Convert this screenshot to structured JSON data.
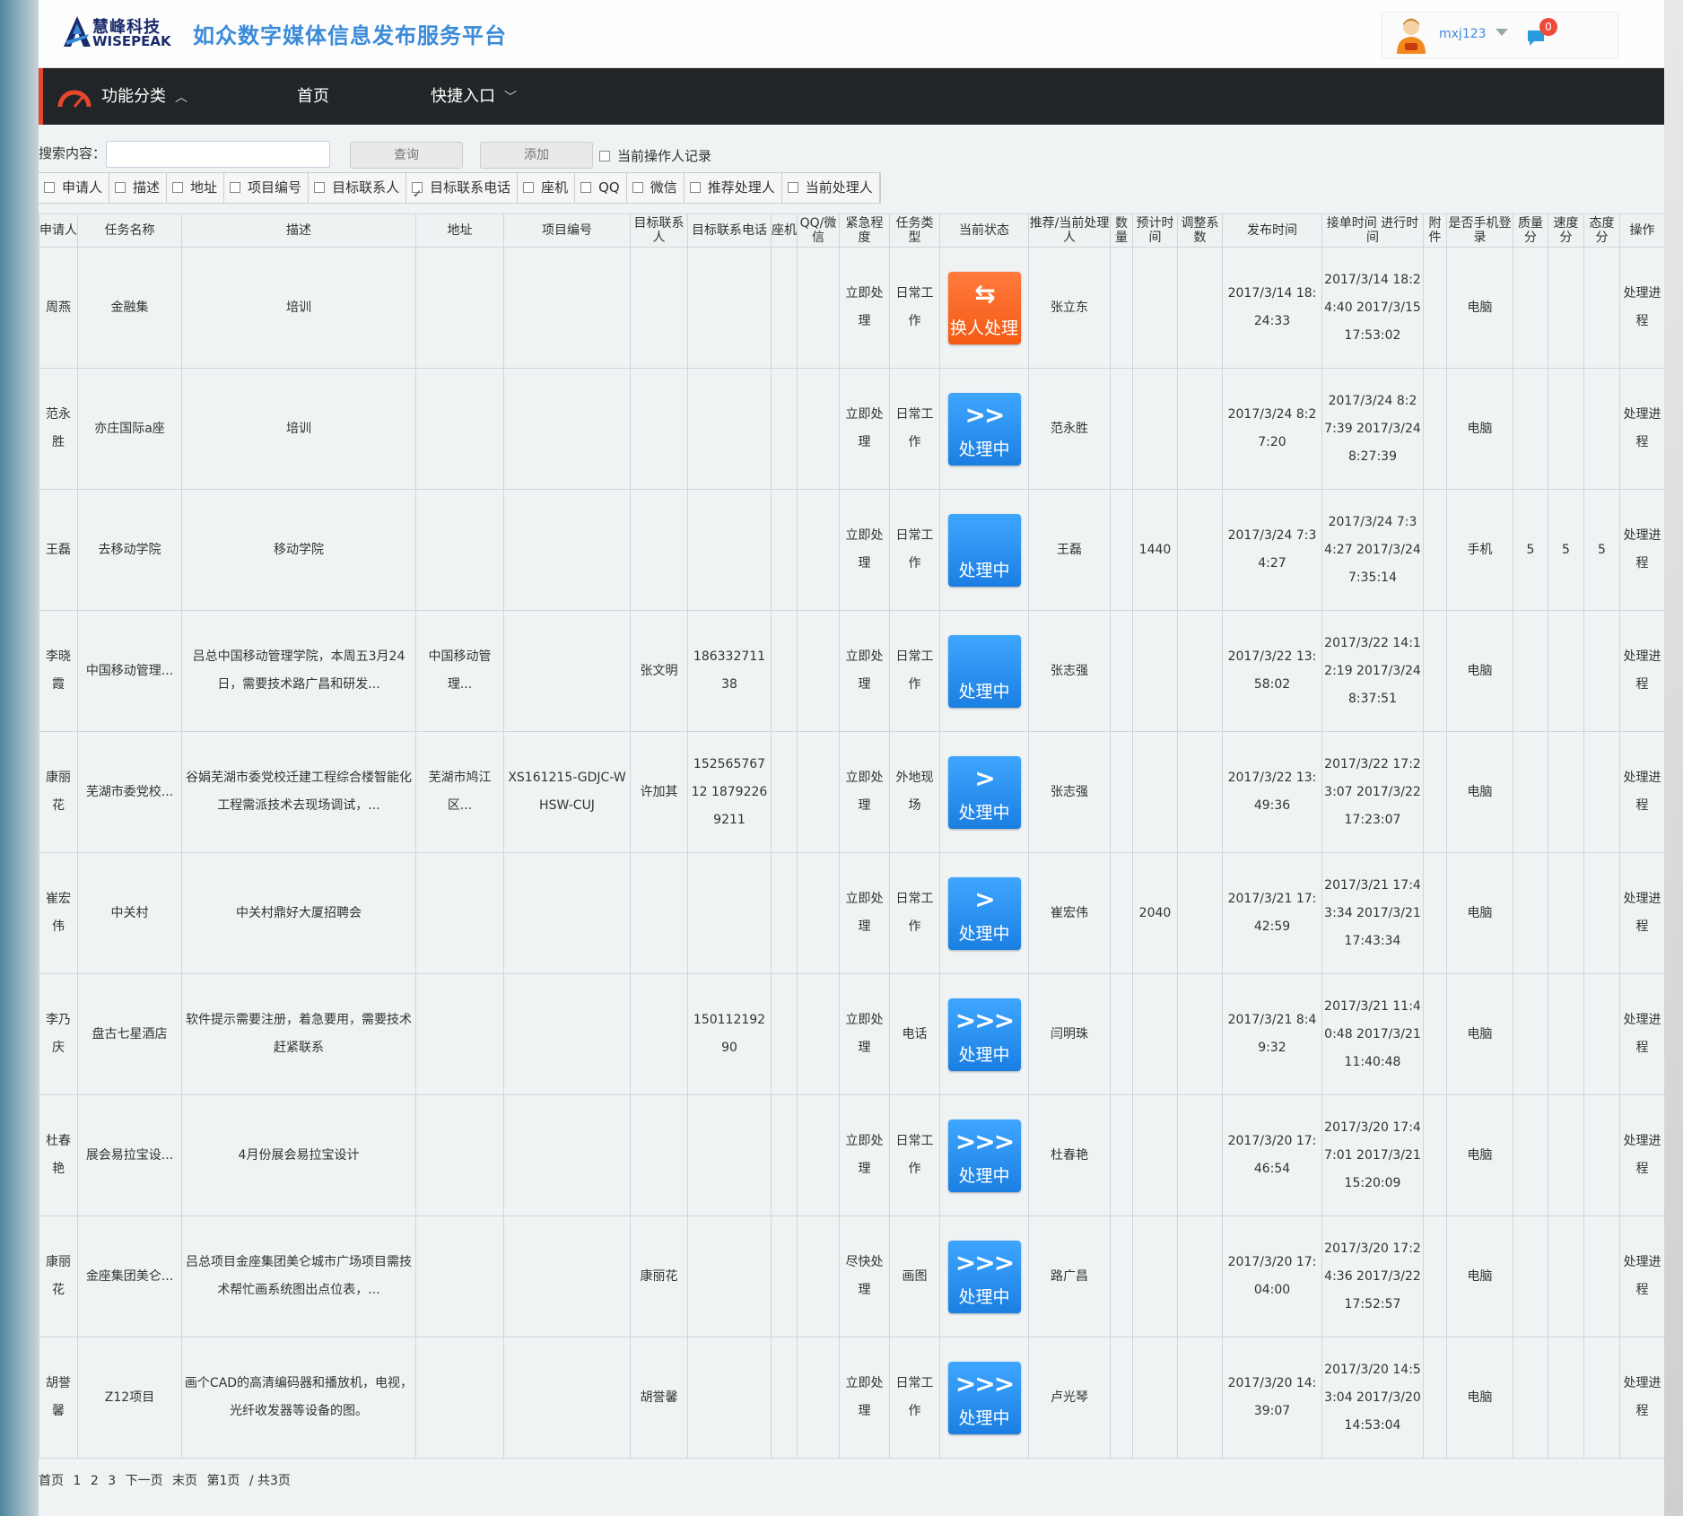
{
  "header": {
    "logo_cn": "慧峰科技",
    "logo_en": "WISEPEAK",
    "site_title": "如众数字媒体信息发布服务平台",
    "username": "mxj123",
    "message_count": "0"
  },
  "nav": {
    "category": "功能分类",
    "home": "首页",
    "quick": "快捷入口"
  },
  "search": {
    "label": "搜索内容：",
    "input_value": "",
    "query_button": "查询",
    "add_button": "添加",
    "current_operator": "当前操作人记录",
    "filters": [
      {
        "label": "申请人",
        "checked": false
      },
      {
        "label": "描述",
        "checked": false
      },
      {
        "label": "地址",
        "checked": false
      },
      {
        "label": "项目编号",
        "checked": false
      },
      {
        "label": "目标联系人",
        "checked": false
      },
      {
        "label": "目标联系电话",
        "checked": true
      },
      {
        "label": "座机",
        "checked": false
      },
      {
        "label": "QQ",
        "checked": false
      },
      {
        "label": "微信",
        "checked": false
      },
      {
        "label": "推荐处理人",
        "checked": false
      },
      {
        "label": "当前处理人",
        "checked": false
      }
    ]
  },
  "table": {
    "columns": [
      "申请人",
      "任务名称",
      "描述",
      "地址",
      "项目编号",
      "目标联系人",
      "目标联系电话",
      "座机",
      "QQ/微信",
      "紧急程度",
      "任务类型",
      "当前状态",
      "推荐/当前处理人",
      "数量",
      "预计时间",
      "调整系数",
      "发布时间",
      "接单时间 进行时间",
      "附件",
      "是否手机登录",
      "质量分",
      "速度分",
      "态度分",
      "操作"
    ],
    "rows": [
      {
        "applicant": "周燕",
        "task": "金融集",
        "desc": "培训",
        "addr": "",
        "code": "",
        "contact": "",
        "phone": "",
        "landline": "",
        "qq": "",
        "urgency": "立即处理",
        "type": "日常工作",
        "status_icon": "⇆",
        "status": "换人处理",
        "status_color": "orange",
        "handler": "张立东",
        "qty": "",
        "est": "",
        "adj": "",
        "publish": "2017/3/14 18:24:33",
        "accept": "2017/3/14 18:24:40 2017/3/15 17:53:02",
        "attach": "",
        "login": "电脑",
        "q": "",
        "s": "",
        "a": "",
        "op": "处理进程"
      },
      {
        "applicant": "范永胜",
        "task": "亦庄国际a座",
        "desc": "培训",
        "addr": "",
        "code": "",
        "contact": "",
        "phone": "",
        "landline": "",
        "qq": "",
        "urgency": "立即处理",
        "type": "日常工作",
        "status_icon": ">>",
        "status": "处理中",
        "status_color": "blue",
        "handler": "范永胜",
        "qty": "",
        "est": "",
        "adj": "",
        "publish": "2017/3/24 8:27:20",
        "accept": "2017/3/24 8:27:39 2017/3/24 8:27:39",
        "attach": "",
        "login": "电脑",
        "q": "",
        "s": "",
        "a": "",
        "op": "处理进程"
      },
      {
        "applicant": "王磊",
        "task": "去移动学院",
        "desc": "移动学院",
        "addr": "",
        "code": "",
        "contact": "",
        "phone": "",
        "landline": "",
        "qq": "",
        "urgency": "立即处理",
        "type": "日常工作",
        "status_icon": "",
        "status": "处理中",
        "status_color": "blue",
        "handler": "王磊",
        "qty": "",
        "est": "1440",
        "adj": "",
        "publish": "2017/3/24 7:34:27",
        "accept": "2017/3/24 7:34:27 2017/3/24 7:35:14",
        "attach": "",
        "login": "手机",
        "q": "5",
        "s": "5",
        "a": "5",
        "op": "处理进程"
      },
      {
        "applicant": "李晓霞",
        "task": "中国移动管理...",
        "desc": "吕总中国移动管理学院，本周五3月24日，需要技术路广昌和研发...",
        "addr": "中国移动管理...",
        "code": "",
        "contact": "张文明",
        "phone": "18633271138",
        "landline": "",
        "qq": "",
        "urgency": "立即处理",
        "type": "日常工作",
        "status_icon": "",
        "status": "处理中",
        "status_color": "blue",
        "handler": "张志强",
        "qty": "",
        "est": "",
        "adj": "",
        "publish": "2017/3/22 13:58:02",
        "accept": "2017/3/22 14:12:19 2017/3/24 8:37:51",
        "attach": "",
        "login": "电脑",
        "q": "",
        "s": "",
        "a": "",
        "op": "处理进程"
      },
      {
        "applicant": "康丽花",
        "task": "芜湖市委党校...",
        "desc": "谷娟芜湖市委党校迁建工程综合楼智能化工程需派技术去现场调试，...",
        "addr": "芜湖市鸠江区...",
        "code": "XS161215-GDJC-WHSW-CUJ",
        "contact": "许加其",
        "phone": "15256576712 18792269211",
        "landline": "",
        "qq": "",
        "urgency": "立即处理",
        "type": "外地现场",
        "status_icon": ">",
        "status": "处理中",
        "status_color": "blue",
        "handler": "张志强",
        "qty": "",
        "est": "",
        "adj": "",
        "publish": "2017/3/22 13:49:36",
        "accept": "2017/3/22 17:23:07 2017/3/22 17:23:07",
        "attach": "",
        "login": "电脑",
        "q": "",
        "s": "",
        "a": "",
        "op": "处理进程"
      },
      {
        "applicant": "崔宏伟",
        "task": "中关村",
        "desc": "中关村鼎好大厦招聘会",
        "addr": "",
        "code": "",
        "contact": "",
        "phone": "",
        "landline": "",
        "qq": "",
        "urgency": "立即处理",
        "type": "日常工作",
        "status_icon": ">",
        "status": "处理中",
        "status_color": "blue",
        "handler": "崔宏伟",
        "qty": "",
        "est": "2040",
        "adj": "",
        "publish": "2017/3/21 17:42:59",
        "accept": "2017/3/21 17:43:34 2017/3/21 17:43:34",
        "attach": "",
        "login": "电脑",
        "q": "",
        "s": "",
        "a": "",
        "op": "处理进程"
      },
      {
        "applicant": "李乃庆",
        "task": "盘古七星酒店",
        "desc": "软件提示需要注册，着急要用，需要技术赶紧联系",
        "addr": "",
        "code": "",
        "contact": "",
        "phone": "15011219290",
        "landline": "",
        "qq": "",
        "urgency": "立即处理",
        "type": "电话",
        "status_icon": ">>>",
        "status": "处理中",
        "status_color": "blue",
        "handler": "闫明珠",
        "qty": "",
        "est": "",
        "adj": "",
        "publish": "2017/3/21 8:49:32",
        "accept": "2017/3/21 11:40:48 2017/3/21 11:40:48",
        "attach": "",
        "login": "电脑",
        "q": "",
        "s": "",
        "a": "",
        "op": "处理进程"
      },
      {
        "applicant": "杜春艳",
        "task": "展会易拉宝设...",
        "desc": "4月份展会易拉宝设计",
        "addr": "",
        "code": "",
        "contact": "",
        "phone": "",
        "landline": "",
        "qq": "",
        "urgency": "立即处理",
        "type": "日常工作",
        "status_icon": ">>>",
        "status": "处理中",
        "status_color": "blue",
        "handler": "杜春艳",
        "qty": "",
        "est": "",
        "adj": "",
        "publish": "2017/3/20 17:46:54",
        "accept": "2017/3/20 17:47:01 2017/3/21 15:20:09",
        "attach": "",
        "login": "电脑",
        "q": "",
        "s": "",
        "a": "",
        "op": "处理进程"
      },
      {
        "applicant": "康丽花",
        "task": "金座集团美仑...",
        "desc": "吕总项目金座集团美仑城市广场项目需技术帮忙画系统图出点位表，...",
        "addr": "",
        "code": "",
        "contact": "康丽花",
        "phone": "",
        "landline": "",
        "qq": "",
        "urgency": "尽快处理",
        "type": "画图",
        "status_icon": ">>>",
        "status": "处理中",
        "status_color": "blue",
        "handler": "路广昌",
        "qty": "",
        "est": "",
        "adj": "",
        "publish": "2017/3/20 17:04:00",
        "accept": "2017/3/20 17:24:36 2017/3/22 17:52:57",
        "attach": "",
        "login": "电脑",
        "q": "",
        "s": "",
        "a": "",
        "op": "处理进程"
      },
      {
        "applicant": "胡誉馨",
        "task": "Z12项目",
        "desc": "画个CAD的高清编码器和播放机，电视，光纤收发器等设备的图。",
        "addr": "",
        "code": "",
        "contact": "胡誉馨",
        "phone": "",
        "landline": "",
        "qq": "",
        "urgency": "立即处理",
        "type": "日常工作",
        "status_icon": ">>>",
        "status": "处理中",
        "status_color": "blue",
        "handler": "卢光琴",
        "qty": "",
        "est": "",
        "adj": "",
        "publish": "2017/3/20 14:39:07",
        "accept": "2017/3/20 14:53:04 2017/3/20 14:53:04",
        "attach": "",
        "login": "电脑",
        "q": "",
        "s": "",
        "a": "",
        "op": "处理进程"
      }
    ]
  },
  "pager": {
    "first": "首页",
    "pages": [
      "1",
      "2",
      "3"
    ],
    "next": "下一页",
    "last": "末页",
    "current": "第1页",
    "total": "/ 共3页"
  }
}
